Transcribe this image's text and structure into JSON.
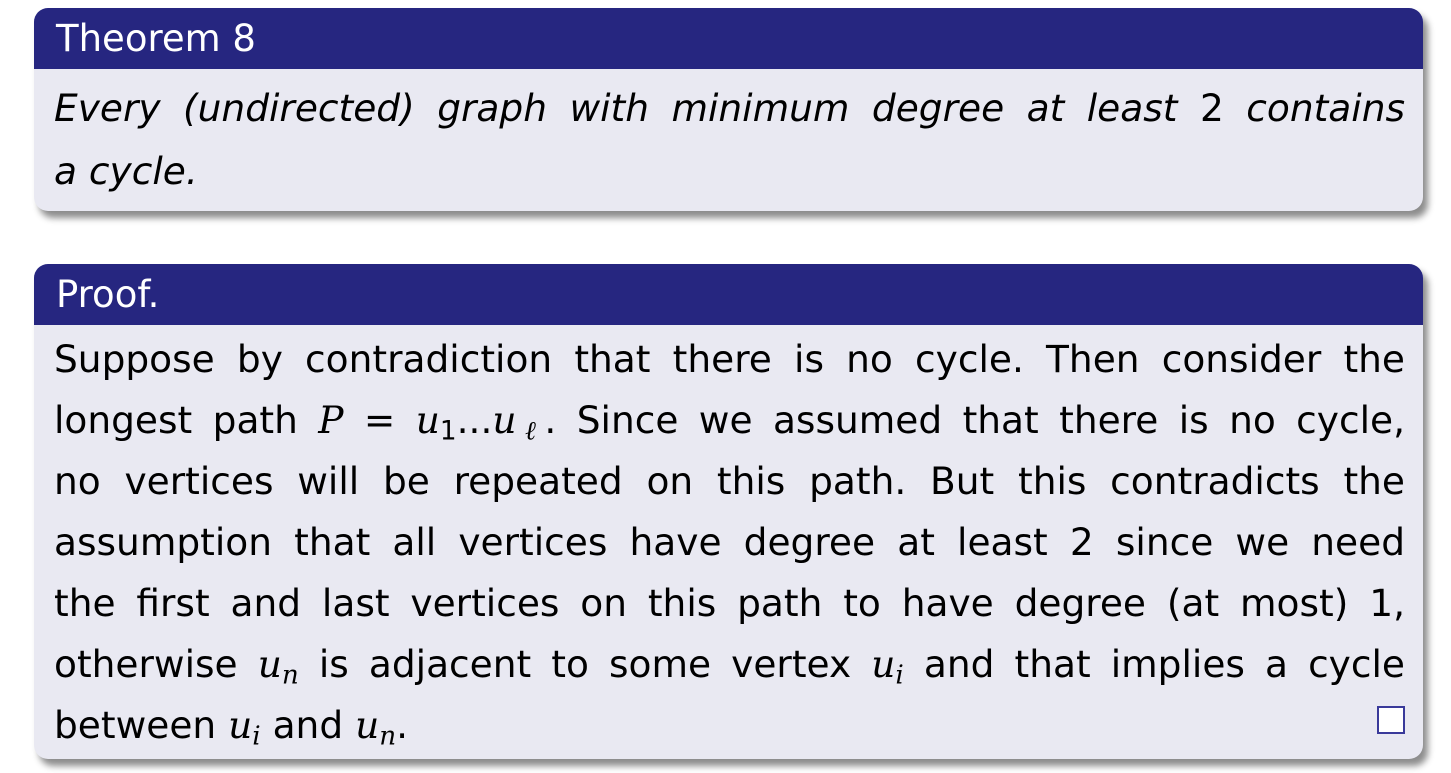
{
  "theorem": {
    "title": "Theorem 8",
    "line1_a": "Every (undirected) graph with minimum degree at least ",
    "line1_num": "2",
    "line1_b": " contains",
    "line2": "a cycle."
  },
  "proof": {
    "title": "Proof.",
    "l1": "Suppose by contradiction that there is no cycle. Then consider the",
    "l2_a": "longest path ",
    "l2_P": "P",
    "l2_eq": " = ",
    "l2_u": "u",
    "l2_1": "1",
    "l2_dots": "...",
    "l2_u2": "u",
    "l2_ell": "ℓ",
    "l2_b": ". Since we assumed that there is no cycle,",
    "l3": "no vertices will be repeated on this path. But this contradicts the",
    "l4": "assumption that all vertices have degree at least 2 since we need",
    "l5": "the first and last vertices on this path to have degree (at most) 1,",
    "l6_a": "otherwise ",
    "l6_u": "u",
    "l6_n": "n",
    "l6_b": " is adjacent to some vertex ",
    "l6_u2": "u",
    "l6_i": "i",
    "l6_c": " and that implies a cycle",
    "l7_a": "between ",
    "l7_u": "u",
    "l7_i": "i",
    "l7_b": " and ",
    "l7_u2": "u",
    "l7_n": "n",
    "l7_c": "."
  },
  "colors": {
    "header_bg": "#262680",
    "body_bg": "#e9e9f2",
    "header_text": "#ffffff"
  },
  "icons": {
    "qed": "qed-square-icon"
  }
}
